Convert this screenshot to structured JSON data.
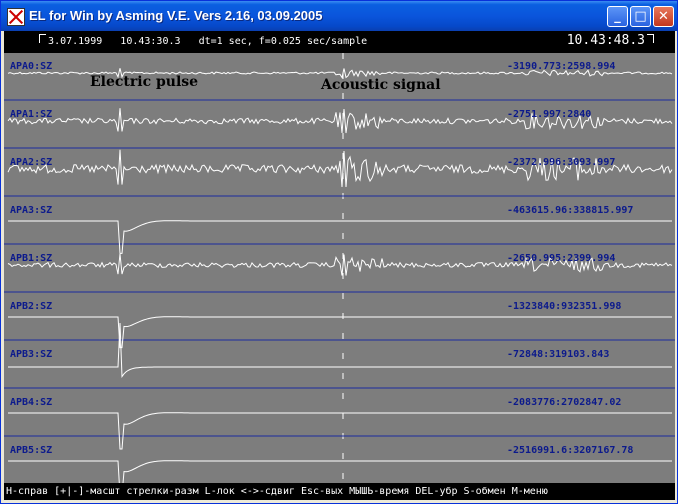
{
  "window": {
    "title": "EL for Win by Asming V.E. Vers 2.16, 03.09.2005"
  },
  "header": {
    "date": "3.07.1999",
    "time": "10.43:30.3",
    "params": "dt=1 sec, f=0.025 sec/sample",
    "cursor_time": "10.43:48.3"
  },
  "annotations": {
    "electric": "Electric pulse",
    "acoustic": "Acoustic signal"
  },
  "traces": [
    {
      "name": "APA0:SZ",
      "range": "-3190.773:2598.994",
      "kind": "noise",
      "amp": 3
    },
    {
      "name": "APA1:SZ",
      "range": "-2751.997:2840",
      "kind": "noise",
      "amp": 8
    },
    {
      "name": "APA2:SZ",
      "range": "-2372.996:3093.997",
      "kind": "noise",
      "amp": 12
    },
    {
      "name": "APA3:SZ",
      "range": "-463615.96:338815.997",
      "kind": "pulse",
      "amp": 18
    },
    {
      "name": "APB1:SZ",
      "range": "-2650.995:2399.994",
      "kind": "noise",
      "amp": 7
    },
    {
      "name": "APB2:SZ",
      "range": "-1323840:932351.998",
      "kind": "pulse",
      "amp": 17
    },
    {
      "name": "APB3:SZ",
      "range": "-72848:319103.843",
      "kind": "spike",
      "amp": 22
    },
    {
      "name": "APB4:SZ",
      "range": "-2083776:2702847.02",
      "kind": "pulse",
      "amp": 20
    },
    {
      "name": "APB5:SZ",
      "range": "-2516991.6:3207167.78",
      "kind": "pulse",
      "amp": 19
    }
  ],
  "status": {
    "text": "H-справ [+|-]-масшт стрелки-разм L-лок <->-сдвиг Esc-вых МЫШЬ-время DEL-убр S-обмен М-меню"
  },
  "colors": {
    "plot_bg": "#7D7D7D",
    "trace": "#FFFFFF",
    "grid": "#1A2AA0",
    "label": "#0C1A8C",
    "titlebar": "#0A55DC"
  }
}
